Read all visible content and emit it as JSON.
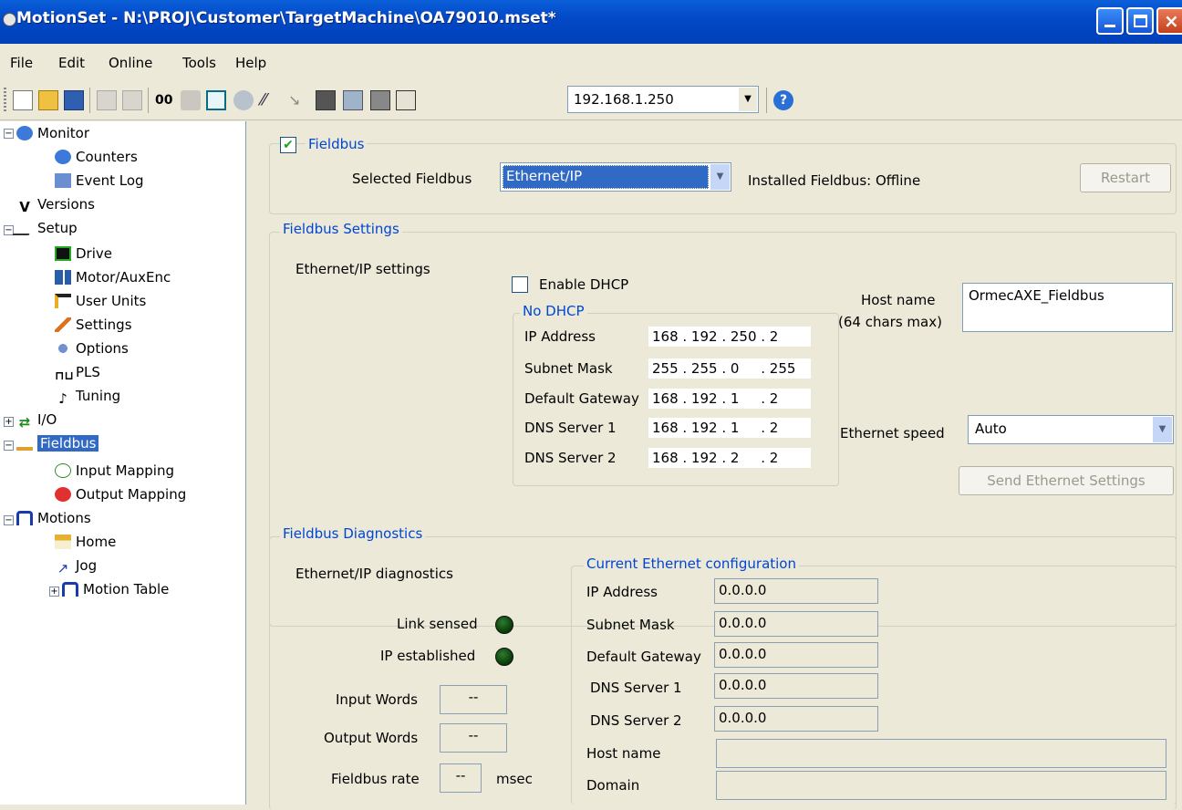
{
  "window": {
    "title": "MotionSet - N:\\PROJ\\Customer\\TargetMachine\\OA79010.mset*"
  },
  "menu": {
    "file": "File",
    "edit": "Edit",
    "online": "Online",
    "tools": "Tools",
    "help": "Help"
  },
  "toolbar": {
    "ip_value": "192.168.1.250"
  },
  "tree": {
    "monitor": "Monitor",
    "counters": "Counters",
    "event_log": "Event Log",
    "versions": "Versions",
    "setup": "Setup",
    "drive": "Drive",
    "motor_auxenc": "Motor/AuxEnc",
    "user_units": "User Units",
    "settings": "Settings",
    "options": "Options",
    "pls": "PLS",
    "tuning": "Tuning",
    "io": "I/O",
    "fieldbus": "Fieldbus",
    "input_mapping": "Input Mapping",
    "output_mapping": "Output Mapping",
    "motions": "Motions",
    "home": "Home",
    "jog": "Jog",
    "motion_table": "Motion Table"
  },
  "fieldbus": {
    "checkbox_label": "Fieldbus",
    "selected_label": "Selected Fieldbus",
    "selected_value": "Ethernet/IP",
    "installed_text": "Installed Fieldbus: Offline",
    "restart": "Restart"
  },
  "settings": {
    "group": "Fieldbus Settings",
    "ethip_settings": "Ethernet/IP settings",
    "enable_dhcp": "Enable DHCP",
    "no_dhcp": "No DHCP",
    "rows": [
      {
        "label": "IP Address",
        "value": "168 . 192 . 250 . 2"
      },
      {
        "label": "Subnet Mask",
        "value": "255 . 255 . 0     . 255"
      },
      {
        "label": "Default Gateway",
        "value": "168 . 192 . 1     . 2"
      },
      {
        "label": "DNS Server 1",
        "value": "168 . 192 . 1     . 2"
      },
      {
        "label": "DNS Server 2",
        "value": "168 . 192 . 2     . 2"
      }
    ],
    "host_name_label": "Host name",
    "host_name_hint": "(64 chars max)",
    "host_name_value": "OrmecAXE_Fieldbus",
    "eth_speed_label": "Ethernet speed",
    "eth_speed_value": "Auto",
    "send_button": "Send Ethernet Settings"
  },
  "diagnostics": {
    "group": "Fieldbus Diagnostics",
    "ethip_diag": "Ethernet/IP diagnostics",
    "link_sensed": "Link sensed",
    "ip_established": "IP established",
    "input_words": "Input Words",
    "input_words_value": "--",
    "output_words": "Output Words",
    "output_words_value": "--",
    "fieldbus_rate": "Fieldbus rate",
    "fieldbus_rate_value": "--",
    "msec": "msec",
    "current_group": "Current Ethernet configuration",
    "current_rows": [
      {
        "label": "IP Address",
        "value": "0.0.0.0"
      },
      {
        "label": "Subnet Mask",
        "value": "0.0.0.0"
      },
      {
        "label": "Default Gateway",
        "value": "0.0.0.0"
      },
      {
        "label": "DNS Server 1",
        "value": "0.0.0.0"
      },
      {
        "label": "DNS Server 2",
        "value": "0.0.0.0"
      }
    ],
    "host_name": "Host name",
    "host_name_value": "",
    "domain": "Domain",
    "domain_value": ""
  }
}
